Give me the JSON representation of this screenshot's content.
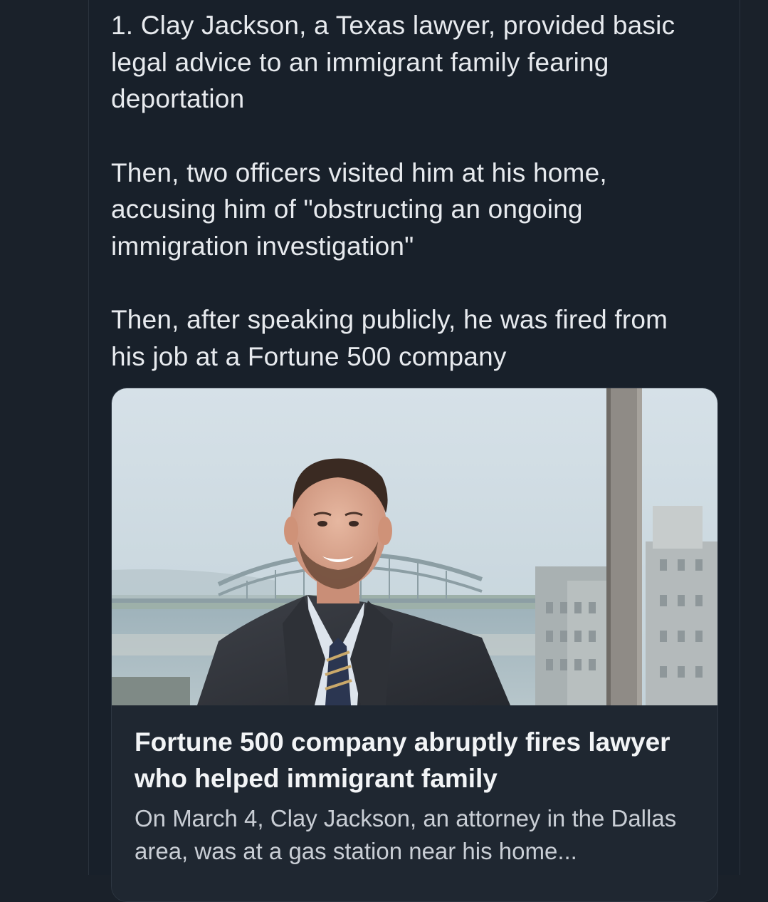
{
  "post": {
    "paragraphs": [
      "1. Clay Jackson, a Texas lawyer, provided basic legal advice to an immigrant family fearing deportation",
      "Then, two officers visited him at his home, accusing him of \"obstructing an ongoing immigration investigation\"",
      "Then, after speaking publicly, he was fired from his job at a Fortune 500 company"
    ]
  },
  "link_card": {
    "image_subject": "portrait-photo",
    "title": "Fortune 500 company abruptly fires lawyer who helped immigrant family",
    "description": "On March 4, Clay Jackson, an attorney in the Dallas area, was at a gas station near his home..."
  },
  "colors": {
    "background": "#1a212a",
    "text": "#e7eaee",
    "card_background": "#1f2731"
  }
}
